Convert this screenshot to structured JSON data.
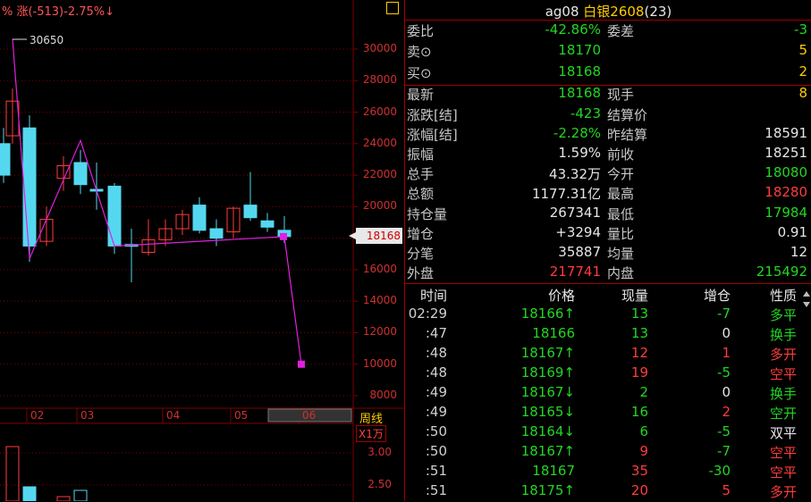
{
  "chart": {
    "ticker_text": "% 涨(-513)-2.75%↓",
    "high_label": "30650",
    "price_tag": "18168",
    "period_label": "周线",
    "unit_label": "X1万",
    "y_ticks": [
      "30000",
      "28000",
      "26000",
      "24000",
      "22000",
      "20000",
      "18000",
      "16000",
      "14000",
      "12000",
      "10000",
      "8000"
    ],
    "x_ticks": [
      "02",
      "03",
      "04",
      "05",
      "06"
    ],
    "sub_ticks": [
      "3.00",
      "2.50"
    ],
    "colors": {
      "up": "#ff3c3c",
      "down": "#54d8f0",
      "line": "#e020e0",
      "grid": "#800000"
    }
  },
  "panel": {
    "symbol": "ag08",
    "name": "白银2608",
    "paren": "(23)",
    "rows": [
      {
        "l1": "委比",
        "v1": "-42.86%",
        "c1": "green",
        "l2": "委差",
        "v2": "-3",
        "c2": "green"
      },
      {
        "l1": "卖⊙",
        "v1": "18170",
        "c1": "green",
        "l2": "",
        "v2": "5",
        "c2": "yellow"
      },
      {
        "l1": "买⊙",
        "v1": "18168",
        "c1": "green",
        "l2": "",
        "v2": "2",
        "c2": "yellow"
      },
      {
        "l1": "最新",
        "v1": "18168",
        "c1": "green",
        "l2": "现手",
        "v2": "8",
        "c2": "yellow"
      },
      {
        "l1": "涨跌[结]",
        "v1": "-423",
        "c1": "green",
        "l2": "结算价",
        "v2": "",
        "c2": "white"
      },
      {
        "l1": "涨幅[结]",
        "v1": "-2.28%",
        "c1": "green",
        "l2": "昨结算",
        "v2": "18591",
        "c2": "white"
      },
      {
        "l1": "振幅",
        "v1": "1.59%",
        "c1": "white",
        "l2": "前收",
        "v2": "18251",
        "c2": "white"
      },
      {
        "l1": "总手",
        "v1": "43.32万",
        "c1": "white",
        "l2": "今开",
        "v2": "18080",
        "c2": "green"
      },
      {
        "l1": "总额",
        "v1": "1177.31亿",
        "c1": "white",
        "l2": "最高",
        "v2": "18280",
        "c2": "red"
      },
      {
        "l1": "持仓量",
        "v1": "267341",
        "c1": "white",
        "l2": "最低",
        "v2": "17984",
        "c2": "green"
      },
      {
        "l1": "增仓",
        "v1": "+3294",
        "c1": "white",
        "l2": "量比",
        "v2": "0.91",
        "c2": "white"
      },
      {
        "l1": "分笔",
        "v1": "35887",
        "c1": "white",
        "l2": "均量",
        "v2": "12",
        "c2": "white"
      },
      {
        "l1": "外盘",
        "v1": "217741",
        "c1": "red",
        "l2": "内盘",
        "v2": "215492",
        "c2": "green"
      }
    ],
    "trade_headers": [
      "时间",
      "价格",
      "现量",
      "增仓",
      "性质"
    ],
    "trades": [
      {
        "time": "02:29",
        "price": "18166↑",
        "pc": "green",
        "vol": "13",
        "vc": "green",
        "oi": "-7",
        "oc": "green",
        "type": "多平",
        "tc": "green"
      },
      {
        "time": ":47",
        "price": "18166",
        "pc": "green",
        "vol": "13",
        "vc": "green",
        "oi": "0",
        "oc": "white",
        "type": "换手",
        "tc": "green"
      },
      {
        "time": ":48",
        "price": "18167↑",
        "pc": "green",
        "vol": "12",
        "vc": "red",
        "oi": "1",
        "oc": "red",
        "type": "多开",
        "tc": "red"
      },
      {
        "time": ":48",
        "price": "18169↑",
        "pc": "green",
        "vol": "19",
        "vc": "red",
        "oi": "-5",
        "oc": "green",
        "type": "空平",
        "tc": "red"
      },
      {
        "time": ":49",
        "price": "18167↓",
        "pc": "green",
        "vol": "2",
        "vc": "green",
        "oi": "0",
        "oc": "white",
        "type": "换手",
        "tc": "green"
      },
      {
        "time": ":49",
        "price": "18165↓",
        "pc": "green",
        "vol": "16",
        "vc": "green",
        "oi": "2",
        "oc": "red",
        "type": "空开",
        "tc": "green"
      },
      {
        "time": ":50",
        "price": "18164↓",
        "pc": "green",
        "vol": "6",
        "vc": "green",
        "oi": "-5",
        "oc": "green",
        "type": "双平",
        "tc": "white"
      },
      {
        "time": ":50",
        "price": "18167↑",
        "pc": "green",
        "vol": "9",
        "vc": "red",
        "oi": "-7",
        "oc": "green",
        "type": "空平",
        "tc": "red"
      },
      {
        "time": ":51",
        "price": "18167",
        "pc": "green",
        "vol": "35",
        "vc": "red",
        "oi": "-30",
        "oc": "green",
        "type": "空平",
        "tc": "red"
      },
      {
        "time": ":51",
        "price": "18175↑",
        "pc": "green",
        "vol": "20",
        "vc": "red",
        "oi": "5",
        "oc": "red",
        "type": "多开",
        "tc": "red"
      }
    ]
  }
}
